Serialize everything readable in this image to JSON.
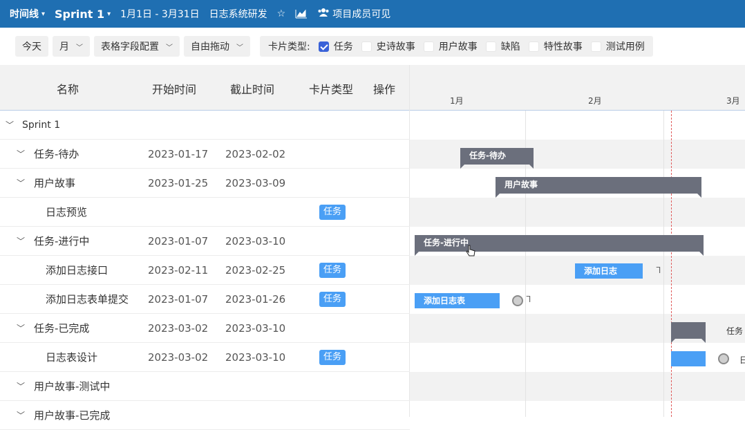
{
  "topbar": {
    "view_label": "时间线",
    "sprint_label": "Sprint 1",
    "date_range": "1月1日 - 3月31日",
    "project": "日志系统研发",
    "members_label": "项目成员可见",
    "icons": [
      "star-icon",
      "chart-icon",
      "users-icon"
    ]
  },
  "toolbar": {
    "today": "今天",
    "scale": "月",
    "field_config": "表格字段配置",
    "drag_mode": "自由拖动",
    "card_type_label": "卡片类型:",
    "card_types": [
      {
        "label": "任务",
        "checked": true
      },
      {
        "label": "史诗故事",
        "checked": false
      },
      {
        "label": "用户故事",
        "checked": false
      },
      {
        "label": "缺陷",
        "checked": false
      },
      {
        "label": "特性故事",
        "checked": false
      },
      {
        "label": "测试用例",
        "checked": false
      }
    ]
  },
  "grid": {
    "headers": {
      "name": "名称",
      "start": "开始时间",
      "end": "截止时间",
      "type": "卡片类型",
      "ops": "操作"
    },
    "rows": [
      {
        "name": "Sprint 1",
        "start": "",
        "end": "",
        "type": "",
        "indent": 0,
        "expand": true
      },
      {
        "name": "任务-待办",
        "start": "2023-01-17",
        "end": "2023-02-02",
        "type": "",
        "indent": 1,
        "expand": true
      },
      {
        "name": "用户故事",
        "start": "2023-01-25",
        "end": "2023-03-09",
        "type": "",
        "indent": 1,
        "expand": true
      },
      {
        "name": "日志预览",
        "start": "",
        "end": "",
        "type": "任务",
        "indent": 2,
        "expand": false
      },
      {
        "name": "任务-进行中",
        "start": "2023-01-07",
        "end": "2023-03-10",
        "type": "",
        "indent": 1,
        "expand": true
      },
      {
        "name": "添加日志接口",
        "start": "2023-02-11",
        "end": "2023-02-25",
        "type": "任务",
        "indent": 2,
        "expand": false
      },
      {
        "name": "添加日志表单提交",
        "start": "2023-01-07",
        "end": "2023-01-26",
        "type": "任务",
        "indent": 2,
        "expand": false
      },
      {
        "name": "任务-已完成",
        "start": "2023-03-02",
        "end": "2023-03-10",
        "type": "",
        "indent": 1,
        "expand": true
      },
      {
        "name": "日志表设计",
        "start": "2023-03-02",
        "end": "2023-03-10",
        "type": "任务",
        "indent": 2,
        "expand": false
      },
      {
        "name": "用户故事-测试中",
        "start": "",
        "end": "",
        "type": "",
        "indent": 1,
        "expand": true
      },
      {
        "name": "用户故事-已完成",
        "start": "",
        "end": "",
        "type": "",
        "indent": 1,
        "expand": true
      }
    ]
  },
  "chart": {
    "months": [
      "1月",
      "2月",
      "3月"
    ],
    "group_bars": {
      "todo": "任务-待办",
      "story": "用户故事",
      "inprogress": "任务-进行中",
      "done_outside": "任务"
    },
    "task_bars": {
      "api": "添加日志",
      "form": "添加日志表",
      "design_outside": "日"
    },
    "colors": {
      "accent": "#1f6fb2",
      "group_bar": "#6b6f7c",
      "task_bar": "#4a9ff5",
      "today_line": "#e05a5a"
    }
  }
}
